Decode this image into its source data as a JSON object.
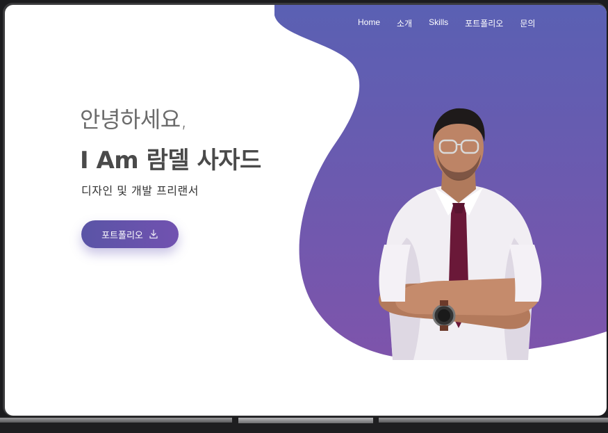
{
  "nav": {
    "items": [
      {
        "label": "Home"
      },
      {
        "label": "소개"
      },
      {
        "label": "Skills"
      },
      {
        "label": "포트폴리오"
      },
      {
        "label": "문의"
      }
    ]
  },
  "hero": {
    "greeting": "안녕하세요,",
    "headline": "I Am 람델 사자드",
    "subtitle": "디자인 및 개발 프리랜서",
    "cta_label": "포트폴리오",
    "cta_icon": "download-icon"
  },
  "colors": {
    "gradient_top": "#5a5fb2",
    "gradient_bottom": "#7b55ac",
    "text_dark": "#4a4a4a",
    "text_light": "#6b6b6b"
  }
}
